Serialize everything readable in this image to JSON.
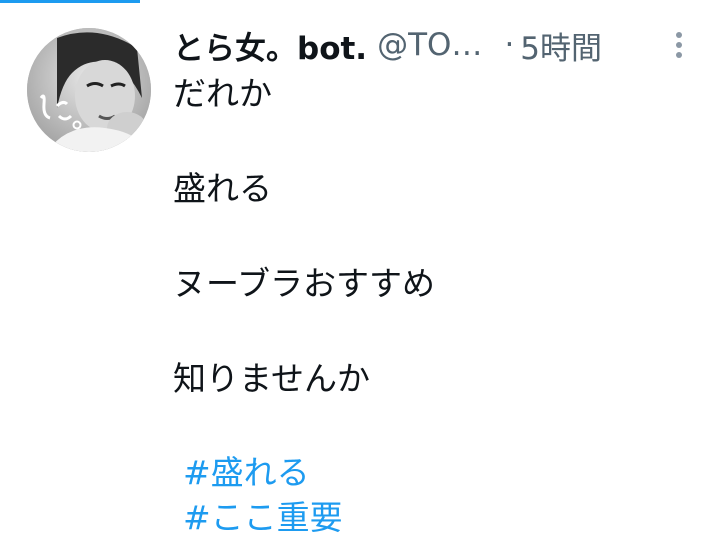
{
  "tweet": {
    "author": {
      "display_name": "とら女。bot.",
      "handle": "@TO…",
      "avatar": {
        "signature_text": "とら。"
      }
    },
    "separator": "·",
    "time": "5時間",
    "more_icon": "vertical-ellipsis-icon",
    "body_lines": [
      "だれか",
      "盛れる",
      "ヌーブラおすすめ",
      "知りませんか"
    ],
    "hashtags": [
      "#盛れる",
      "#ここ重要"
    ]
  },
  "colors": {
    "accent": "#1d9bf0",
    "text": "#0f1419",
    "muted": "#536471"
  }
}
